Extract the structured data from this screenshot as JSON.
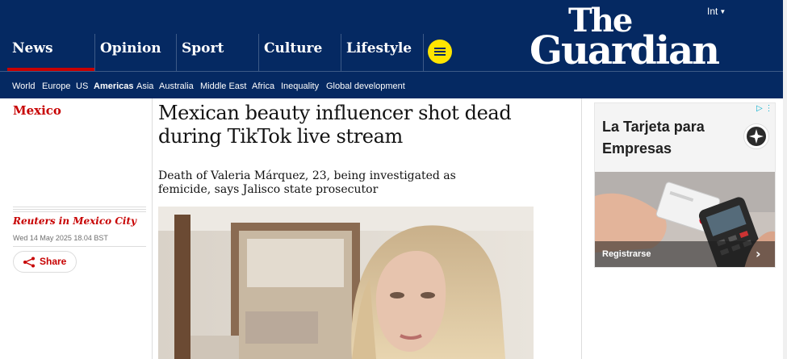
{
  "header": {
    "edition": "Int",
    "logo_line1": "The",
    "logo_line2": "Guardian",
    "pillars": [
      {
        "label": "News"
      },
      {
        "label": "Opinion"
      },
      {
        "label": "Sport"
      },
      {
        "label": "Culture"
      },
      {
        "label": "Lifestyle"
      }
    ],
    "menu_icon": "hamburger-menu-icon",
    "subnav": [
      "World",
      "Europe",
      "US",
      "Americas",
      "Asia",
      "Australia",
      "Middle East",
      "Africa",
      "Inequality",
      "Global development"
    ],
    "subnav_active": "Americas"
  },
  "article": {
    "section": "Mexico",
    "headline": "Mexican beauty influencer shot dead during TikTok live stream",
    "standfirst": "Death of Valeria Márquez, 23, being investigated as femicide, says Jalisco state prosecutor",
    "byline": "Reuters in Mexico City",
    "date": "Wed 14 May 2025 18.04 BST",
    "share_label": "Share"
  },
  "ad": {
    "headline": "La Tarjeta para Empresas",
    "cta": "Registrarse"
  },
  "colors": {
    "brand_blue": "#052962",
    "news_red": "#c70000",
    "menu_yellow": "#ffe500"
  }
}
